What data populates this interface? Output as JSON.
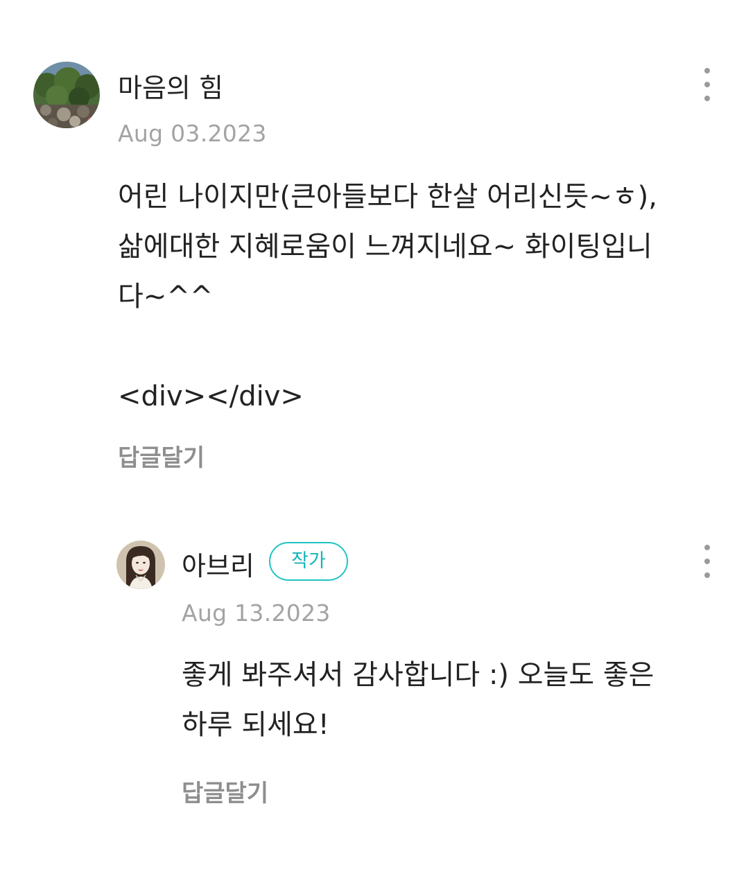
{
  "comments": [
    {
      "author": "마음의 힘",
      "date": "Aug 03.2023",
      "text": "어린 나이지만(큰아들보다 한살 어리신듯~ㅎ),\n삶에대한 지혜로움이 느껴지네요~ 화이팅입니\n다~^^\n\n<div></div>",
      "reply_label": "답글달기",
      "more_icon": "more-vertical-icon",
      "avatar_icon": "landscape-trees-photo"
    },
    {
      "author": "아브리",
      "badge": "작가",
      "date": "Aug 13.2023",
      "text": "좋게 봐주셔서 감사합니다 :) 오늘도 좋은\n하루 되세요!",
      "reply_label": "답글달기",
      "more_icon": "more-vertical-icon",
      "avatar_icon": "illustrated-woman-portrait"
    }
  ],
  "colors": {
    "badge_accent": "#1fc4c4",
    "date_gray": "#a3a3a3",
    "reply_gray": "#8e8e8e",
    "text_primary": "#222222"
  }
}
